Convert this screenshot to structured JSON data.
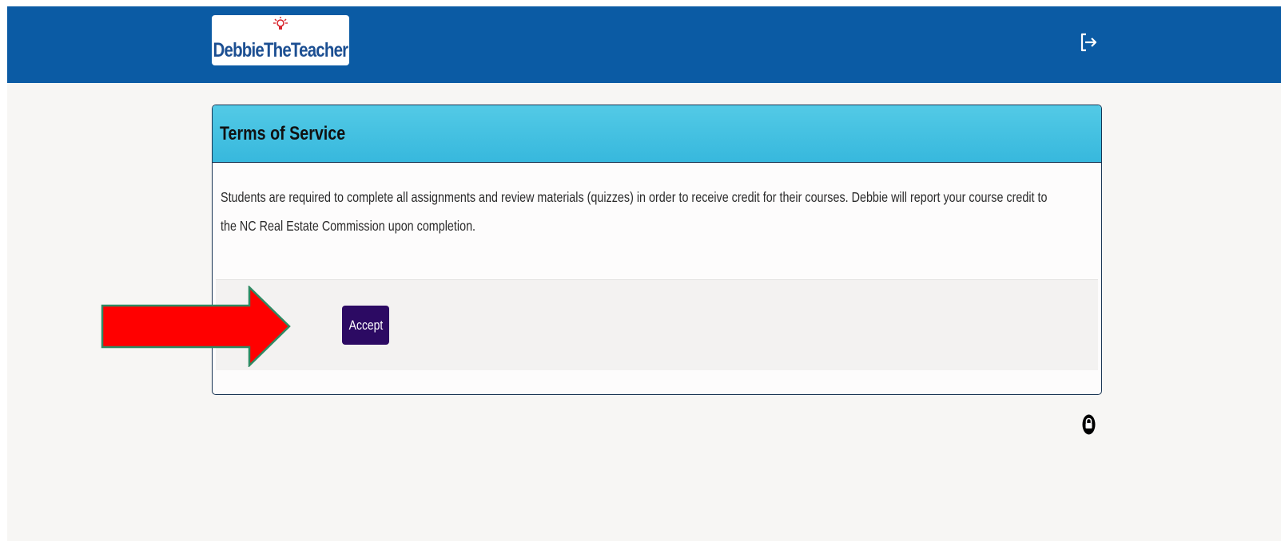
{
  "brand": {
    "logo_text": "DebbieTheTeacher"
  },
  "navbar": {
    "logout_icon": "logout-icon"
  },
  "terms": {
    "title": "Terms of Service",
    "body": "Students are required to complete all assignments and review materials (quizzes) in order to receive credit for their courses. Debbie will report your course credit to the NC Real Estate Commission upon completion.",
    "accept_label": "Accept"
  },
  "annotation": {
    "arrow_icon": "red-arrow-annotation",
    "arrow_color": "#ff0000"
  },
  "footer": {
    "lock_icon": "lock-icon"
  },
  "colors": {
    "navbar": "#0b5ba4",
    "header_gradient_top": "#53cae6",
    "header_gradient_bottom": "#37b8dd",
    "accept_button": "#2c0a63",
    "logo_text": "#1c4f92"
  }
}
